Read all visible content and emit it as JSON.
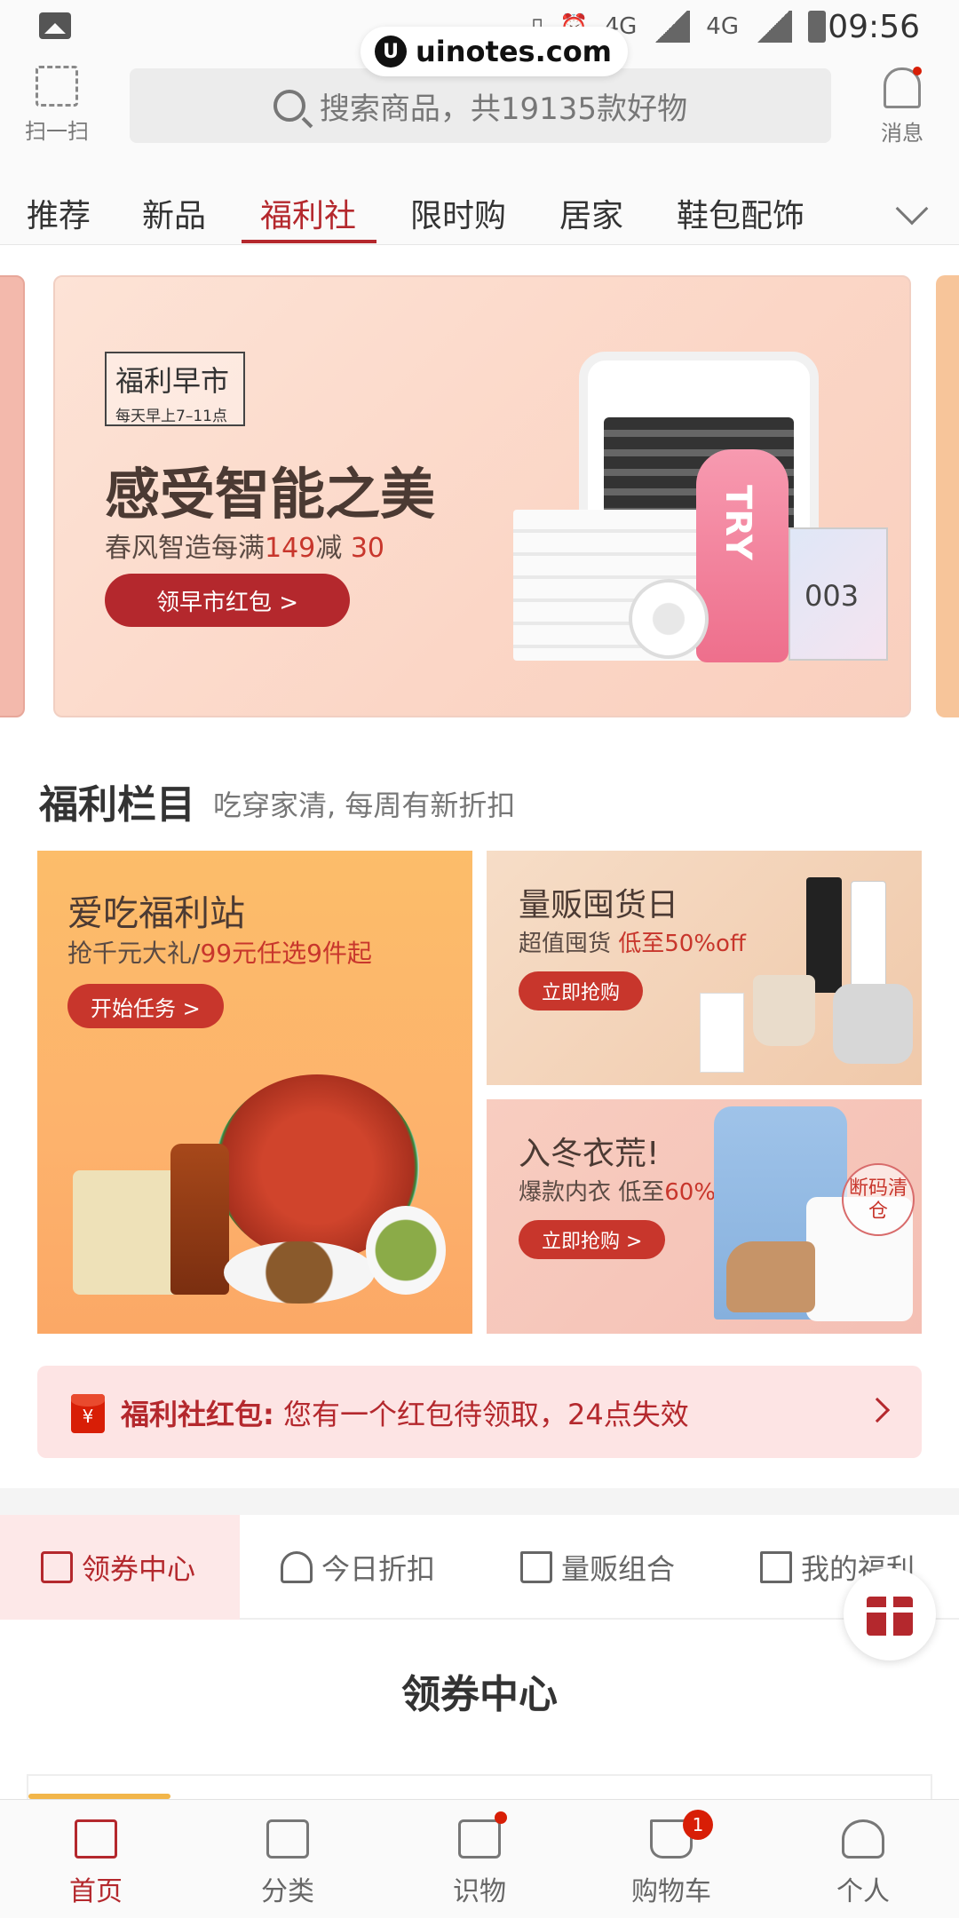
{
  "status_bar": {
    "time": "09:56",
    "network": "4G",
    "network2": "4G"
  },
  "watermark": {
    "logo": "U",
    "text": "uinotes.com"
  },
  "header": {
    "scan_label": "扫一扫",
    "search_placeholder": "搜索商品，共19135款好物",
    "message_label": "消息"
  },
  "tabs": [
    "推荐",
    "新品",
    "福利社",
    "限时购",
    "居家",
    "鞋包配饰"
  ],
  "active_tab": "福利社",
  "banner": {
    "badge_title": "福利早市",
    "badge_sub": "每天早上7–11点",
    "title": "感受智能之美",
    "subtitle_prefix": "春风智造每满",
    "subtitle_num1": "149",
    "subtitle_mid": "减",
    "subtitle_num2": "30",
    "button": "领早市红包 >",
    "product_text": "TRY",
    "card_number": "003"
  },
  "section": {
    "title": "福利栏目",
    "subtitle": "吃穿家清, 每周有新折扣"
  },
  "cards": {
    "food": {
      "title": "爱吃福利站",
      "sub_prefix": "抢千元大礼/",
      "sub_hl": "99元任选9件起",
      "button": "开始任务 >"
    },
    "bulk": {
      "title": "量贩囤货日",
      "sub_prefix": "超值囤货 ",
      "sub_hl": "低至50%off",
      "button": "立即抢购"
    },
    "winter": {
      "title": "入冬衣荒!",
      "sub_prefix": "爆款内衣 低至",
      "sub_hl": "60%off",
      "button": "立即抢购 >",
      "stamp": "断码清仓"
    }
  },
  "notice": {
    "icon": "¥",
    "bold": "福利社红包:",
    "text": " 您有一个红包待领取，24点失效"
  },
  "subtabs": [
    "领券中心",
    "今日折扣",
    "量贩组合",
    "我的福利"
  ],
  "center_title": "领券中心",
  "bottom_nav": [
    {
      "label": "首页",
      "icon": "home-icon"
    },
    {
      "label": "分类",
      "icon": "category-icon"
    },
    {
      "label": "识物",
      "icon": "discover-icon"
    },
    {
      "label": "购物车",
      "icon": "cart-icon",
      "badge": "1"
    },
    {
      "label": "个人",
      "icon": "user-icon"
    }
  ],
  "colors": {
    "accent": "#b4282d",
    "badge": "#d81e06"
  }
}
